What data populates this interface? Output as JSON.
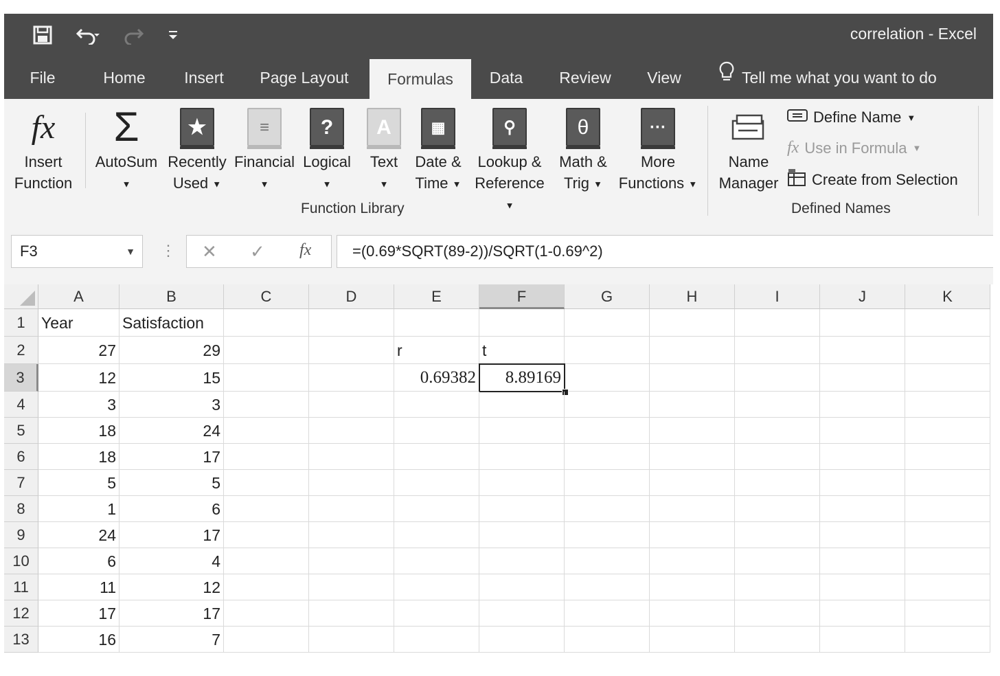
{
  "window": {
    "title": "correlation  -  Excel"
  },
  "quick_access": {
    "icons": [
      "save-icon",
      "undo-icon",
      "redo-icon",
      "customize-icon"
    ]
  },
  "tabs": [
    "File",
    "Home",
    "Insert",
    "Page Layout",
    "Formulas",
    "Data",
    "Review",
    "View"
  ],
  "active_tab": "Formulas",
  "tell_me": "Tell me what you want to do",
  "ribbon": {
    "insert_function": {
      "line1": "Insert",
      "line2": "Function"
    },
    "autosum": {
      "line1": "AutoSum"
    },
    "recently_used": {
      "line1": "Recently",
      "line2": "Used"
    },
    "financial": {
      "line1": "Financial"
    },
    "logical": {
      "line1": "Logical"
    },
    "text": {
      "line1": "Text"
    },
    "date_time": {
      "line1": "Date &",
      "line2": "Time"
    },
    "lookup": {
      "line1": "Lookup &",
      "line2": "Reference"
    },
    "math": {
      "line1": "Math &",
      "line2": "Trig"
    },
    "more": {
      "line1": "More",
      "line2": "Functions"
    },
    "function_library_label": "Function Library",
    "name_manager": {
      "line1": "Name",
      "line2": "Manager"
    },
    "define_name": "Define Name",
    "use_in_formula": "Use in Formula",
    "create_from_selection": "Create from Selection",
    "defined_names_label": "Defined Names"
  },
  "formula_bar": {
    "name_box": "F3",
    "fx_label": "fx",
    "formula": "=(0.69*SQRT(89-2))/SQRT(1-0.69^2)"
  },
  "sheet": {
    "columns": [
      "A",
      "B",
      "C",
      "D",
      "E",
      "F",
      "G",
      "H",
      "I",
      "J",
      "K"
    ],
    "selected_column": "F",
    "selected_row": "3",
    "rows": [
      {
        "n": "1",
        "A": "Year",
        "B": "Satisfaction",
        "E": "",
        "F": ""
      },
      {
        "n": "2",
        "A": "27",
        "B": "29",
        "E": "r",
        "F": "t"
      },
      {
        "n": "3",
        "A": "12",
        "B": "15",
        "E": "0.69382",
        "F": "8.89169"
      },
      {
        "n": "4",
        "A": "3",
        "B": "3",
        "E": "",
        "F": ""
      },
      {
        "n": "5",
        "A": "18",
        "B": "24",
        "E": "",
        "F": ""
      },
      {
        "n": "6",
        "A": "18",
        "B": "17",
        "E": "",
        "F": ""
      },
      {
        "n": "7",
        "A": "5",
        "B": "5",
        "E": "",
        "F": ""
      },
      {
        "n": "8",
        "A": "1",
        "B": "6",
        "E": "",
        "F": ""
      },
      {
        "n": "9",
        "A": "24",
        "B": "17",
        "E": "",
        "F": ""
      },
      {
        "n": "10",
        "A": "6",
        "B": "4",
        "E": "",
        "F": ""
      },
      {
        "n": "11",
        "A": "11",
        "B": "12",
        "E": "",
        "F": ""
      },
      {
        "n": "12",
        "A": "17",
        "B": "17",
        "E": "",
        "F": ""
      },
      {
        "n": "13",
        "A": "16",
        "B": "7",
        "E": "",
        "F": ""
      }
    ]
  }
}
